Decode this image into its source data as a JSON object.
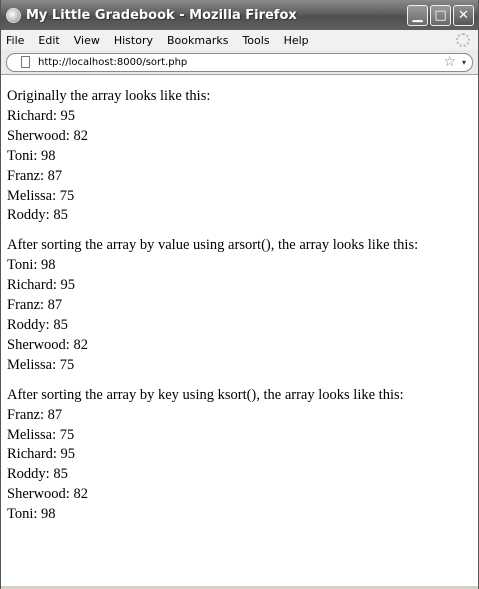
{
  "window": {
    "title": "My Little Gradebook - Mozilla Firefox",
    "minimize": "▁",
    "maximize": "□",
    "close": "✕"
  },
  "menu": [
    "File",
    "Edit",
    "View",
    "History",
    "Bookmarks",
    "Tools",
    "Help"
  ],
  "address": {
    "url": "http://localhost:8000/sort.php",
    "star": "☆",
    "dropdown": "▾"
  },
  "sections": [
    {
      "heading": "Originally the array looks like this:",
      "items": [
        "Richard: 95",
        "Sherwood: 82",
        "Toni: 98",
        "Franz: 87",
        "Melissa: 75",
        "Roddy: 85"
      ]
    },
    {
      "heading": "After sorting the array by value using arsort(), the array looks like this:",
      "items": [
        "Toni: 98",
        "Richard: 95",
        "Franz: 87",
        "Roddy: 85",
        "Sherwood: 82",
        "Melissa: 75"
      ]
    },
    {
      "heading": "After sorting the array by key using ksort(), the array looks like this:",
      "items": [
        "Franz: 87",
        "Melissa: 75",
        "Richard: 95",
        "Roddy: 85",
        "Sherwood: 82",
        "Toni: 98"
      ]
    }
  ]
}
